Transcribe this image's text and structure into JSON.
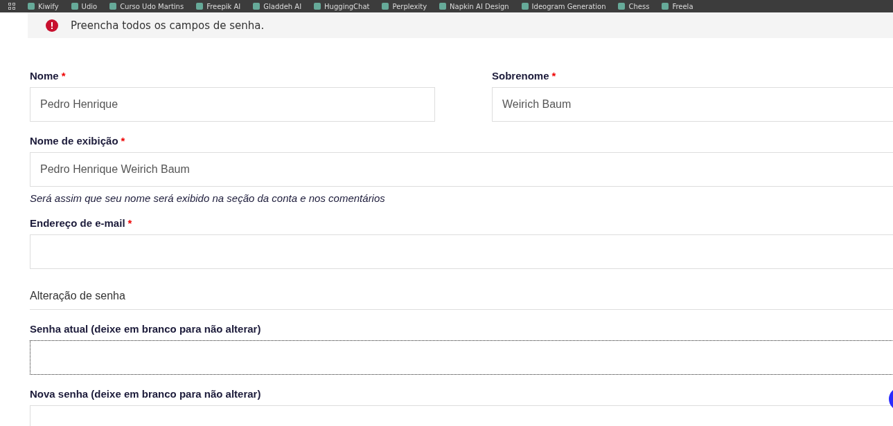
{
  "bookmarks": [
    "Kiwify",
    "Udio",
    "Curso Udo Martins",
    "Freepik AI",
    "Gladdeh AI",
    "HuggingChat",
    "Perplexity",
    "Napkin AI Design",
    "Ideogram Generation",
    "Chess",
    "Freela"
  ],
  "notice": {
    "text": "Preencha todos os campos de senha."
  },
  "name_row": [
    {
      "label": "Nome",
      "required_mark": "*",
      "value": "Pedro Henrique"
    },
    {
      "label": "Sobrenome",
      "required_mark": "*",
      "value": "Weirich Baum"
    }
  ],
  "fields": [
    {
      "kind": "field",
      "label": "Nome de exibição",
      "required_mark": "*",
      "value": "Pedro Henrique Weirich Baum",
      "focused": false,
      "hint": "Será assim que seu nome será exibido na seção da conta e nos comentários"
    },
    {
      "kind": "field",
      "label": "Endereço de e-mail",
      "required_mark": "*",
      "focused": false
    },
    {
      "kind": "heading",
      "label": "Alteração de senha"
    },
    {
      "kind": "field",
      "label": "Senha atual (deixe em branco para não alterar)",
      "focused": true
    },
    {
      "kind": "field",
      "label": "Nova senha (deixe em branco para não alterar)",
      "focused": false
    }
  ]
}
